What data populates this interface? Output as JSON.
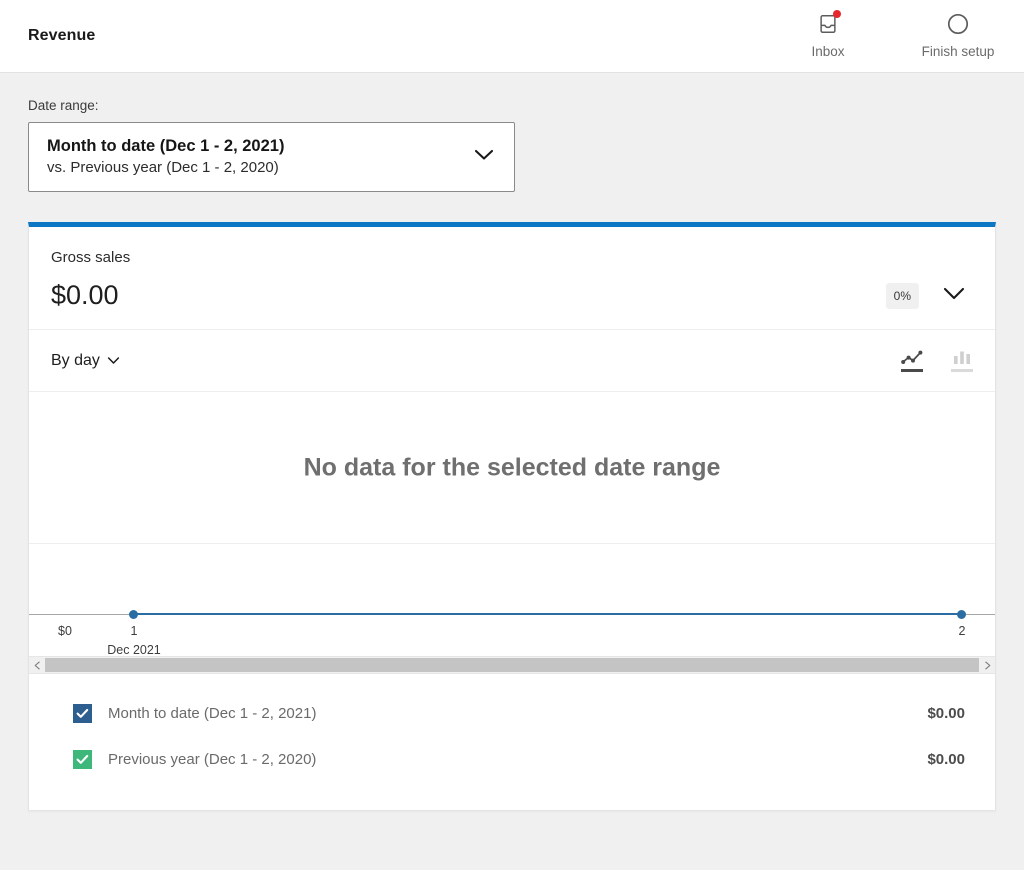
{
  "header": {
    "title": "Revenue",
    "actions": [
      {
        "icon": "inbox-icon",
        "label": "Inbox",
        "has_badge": true,
        "badge_color": "#e8262d"
      },
      {
        "icon": "setup-progress-icon",
        "label": "Finish setup",
        "has_badge": false
      }
    ]
  },
  "date_range": {
    "label": "Date range:",
    "primary": "Month to date (Dec 1 - 2, 2021)",
    "secondary": "vs. Previous year (Dec 1 - 2, 2020)",
    "chevron": "chevron-down-icon"
  },
  "card": {
    "accent_color": "#0c78c4",
    "summary": {
      "label": "Gross sales",
      "value": "$0.00",
      "delta": "0%",
      "expand_icon": "chevron-down-icon"
    },
    "controls": {
      "interval_label": "By day",
      "interval_chevron": "chevron-down-icon",
      "chart_types": [
        {
          "name": "line-chart-icon",
          "selected": true
        },
        {
          "name": "bar-chart-icon",
          "selected": false
        }
      ]
    },
    "empty_message": "No data for the selected date range",
    "scrollbar": {
      "left_arrow": "scroll-left-arrow-icon",
      "right_arrow": "scroll-right-arrow-icon"
    },
    "legend": [
      {
        "label": "Month to date (Dec 1 - 2, 2021)",
        "value": "$0.00",
        "color": "#2c5e8f",
        "checked": true
      },
      {
        "label": "Previous year (Dec 1 - 2, 2020)",
        "value": "$0.00",
        "color": "#3eb87a",
        "checked": true
      }
    ]
  },
  "chart_data": {
    "type": "line",
    "title": "Gross sales",
    "empty_state": "No data for the selected date range",
    "interval": "By day",
    "xlabel": "Dec 2021",
    "ylabel": "",
    "x": [
      "1",
      "2"
    ],
    "xtick_labels": [
      "1",
      "2"
    ],
    "xtick_sublabel": "Dec 2021",
    "ytick_labels": [
      "$0"
    ],
    "ylim": [
      0,
      0
    ],
    "grid": false,
    "legend_position": "bottom",
    "series": [
      {
        "name": "Month to date (Dec 1 - 2, 2021)",
        "values": [
          0,
          0
        ],
        "total": "$0.00",
        "color": "#2c5e8f",
        "visible": true
      },
      {
        "name": "Previous year (Dec 1 - 2, 2020)",
        "values": [
          0,
          0
        ],
        "total": "$0.00",
        "color": "#3eb87a",
        "visible": true
      }
    ]
  }
}
